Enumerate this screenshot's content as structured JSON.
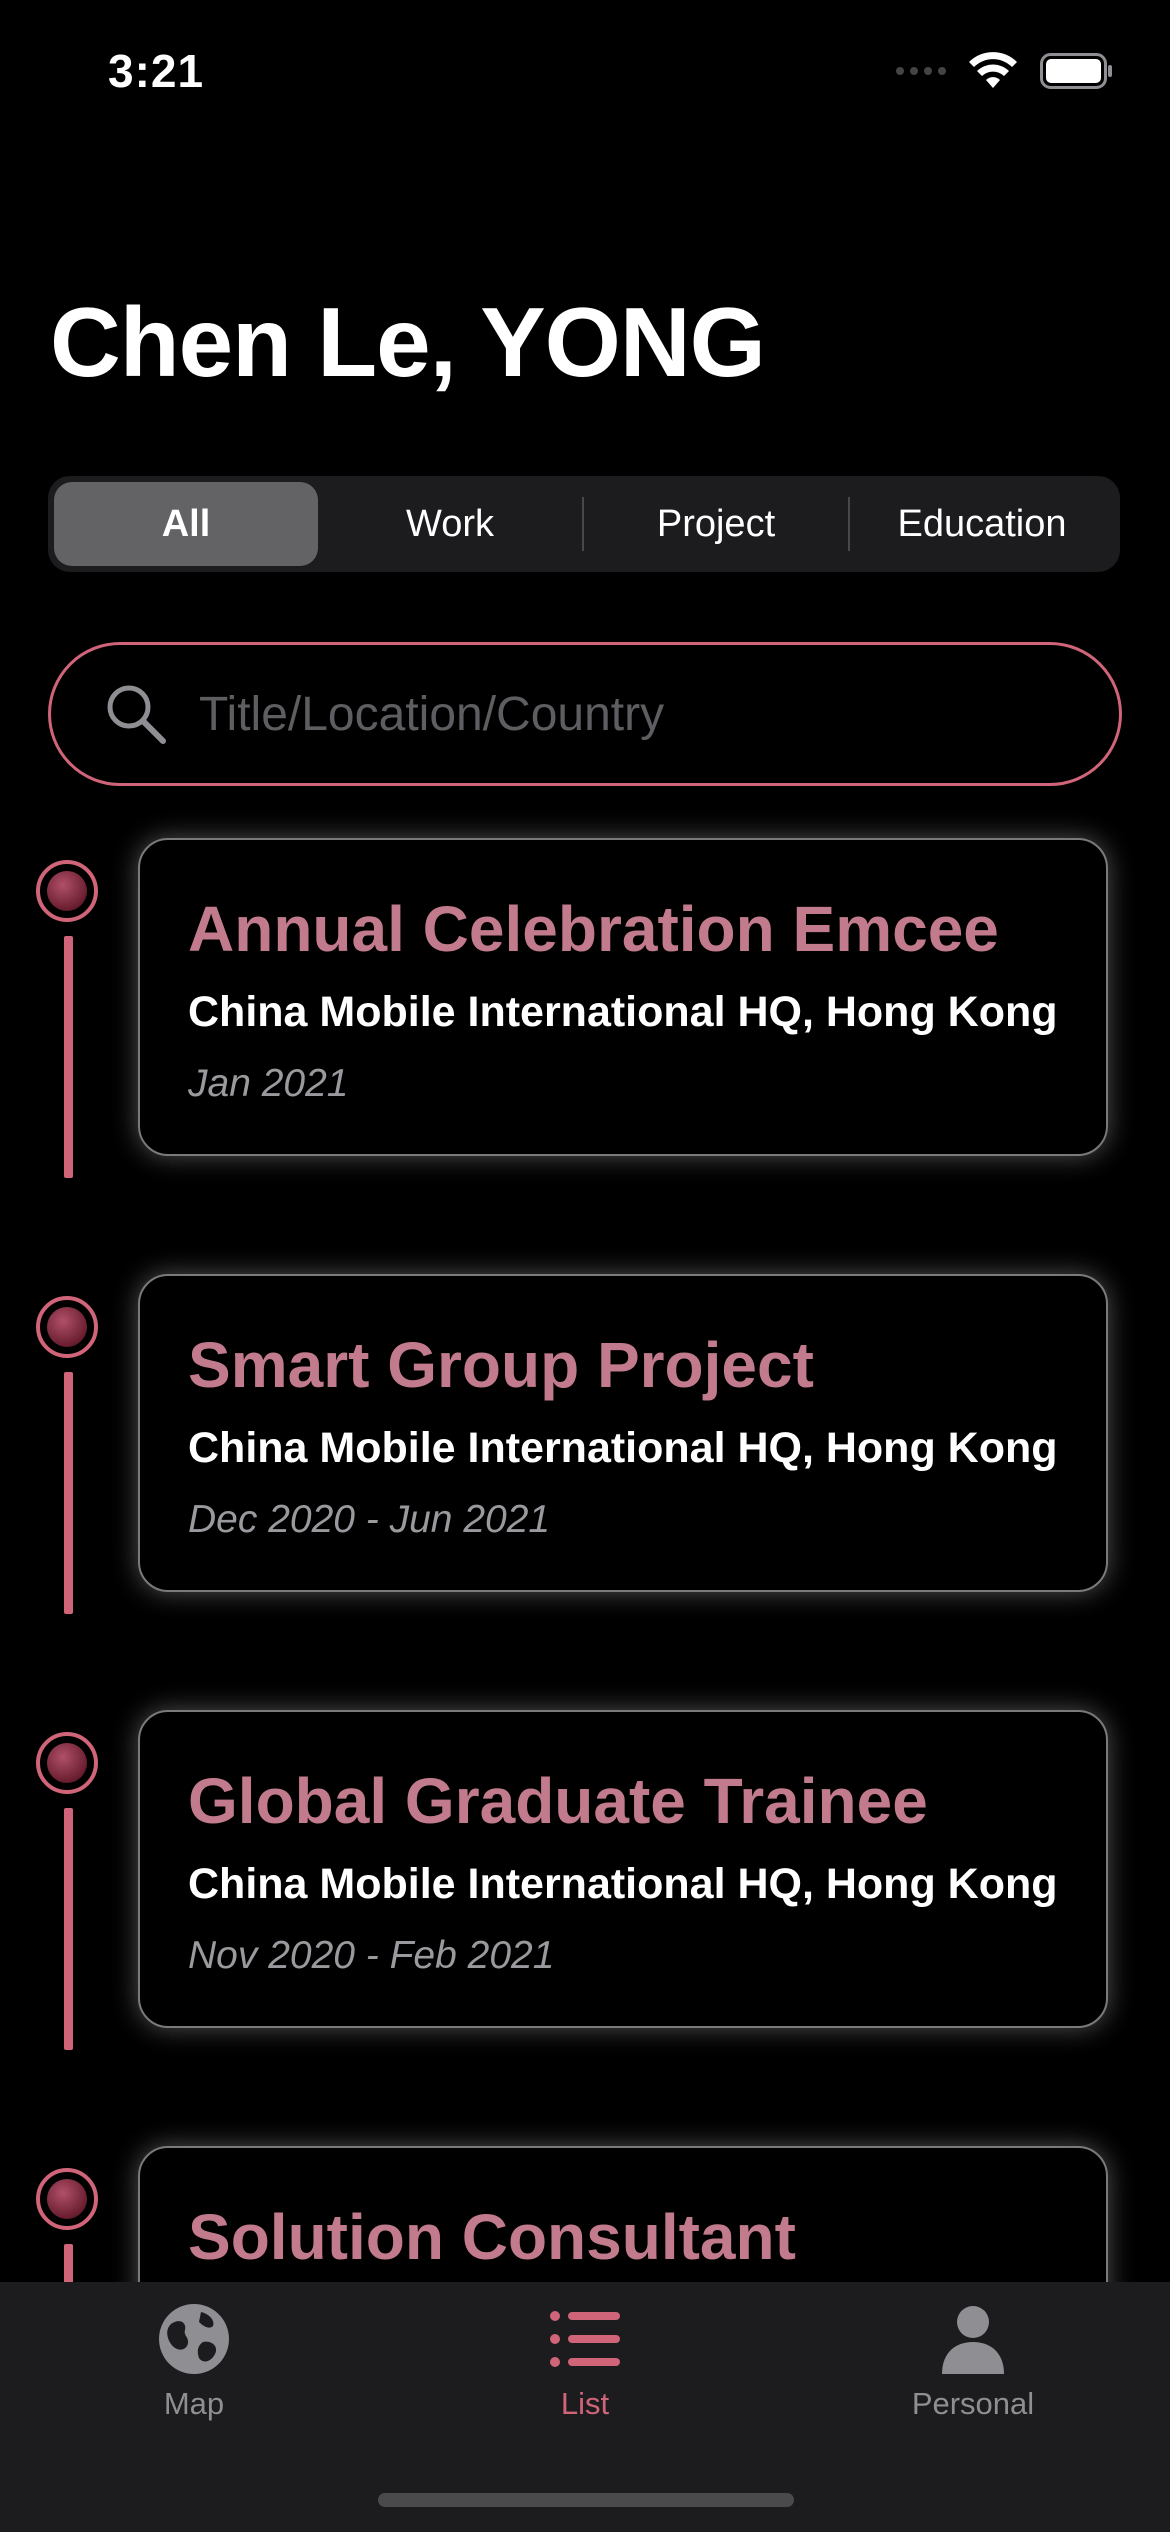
{
  "status_bar": {
    "time": "3:21"
  },
  "header": {
    "title": "Chen Le, YONG"
  },
  "filter": {
    "segments": [
      "All",
      "Work",
      "Project",
      "Education"
    ],
    "selected": "All"
  },
  "search": {
    "placeholder": "Title/Location/Country"
  },
  "entries": [
    {
      "title": "Annual Celebration Emcee",
      "location": "China Mobile International HQ, Hong Kong",
      "date": "Jan 2021"
    },
    {
      "title": "Smart Group Project",
      "location": "China Mobile International HQ, Hong Kong",
      "date": "Dec 2020 - Jun 2021"
    },
    {
      "title": "Global Graduate Trainee",
      "location": "China Mobile International HQ, Hong Kong",
      "date": "Nov 2020 - Feb 2021"
    },
    {
      "title": "Solution Consultant",
      "location": "",
      "date": ""
    }
  ],
  "tab_bar": {
    "tabs": [
      {
        "label": "Map",
        "icon": "globe-icon"
      },
      {
        "label": "List",
        "icon": "list-icon"
      },
      {
        "label": "Personal",
        "icon": "person-icon"
      }
    ],
    "active": "List"
  },
  "colors": {
    "accent": "#d06479",
    "card_title": "#c27b8c",
    "background": "#000000",
    "tab_bar": "#1c1c1e"
  }
}
